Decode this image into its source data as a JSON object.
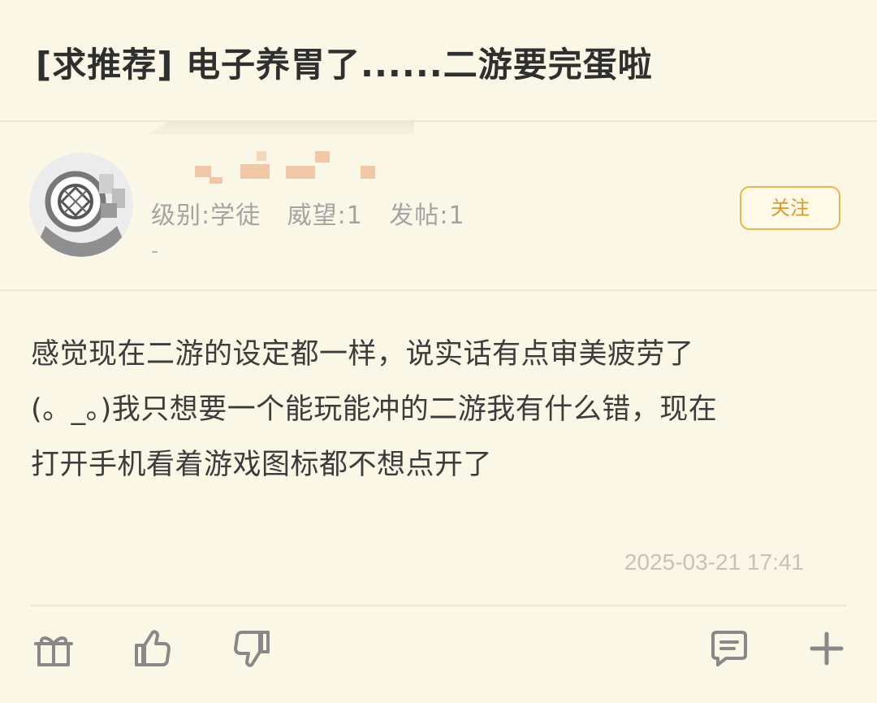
{
  "post": {
    "title": "[求推荐] 电子养胃了......二游要完蛋啦",
    "content": [
      "感觉现在二游的设定都一样，说实话有点审美疲劳了",
      "(。_。)我只想要一个能玩能冲的二游我有什么错，现在",
      "打开手机看着游戏图标都不想点开了"
    ],
    "timestamp": "2025-03-21 17:41"
  },
  "author": {
    "level": "级别:学徒",
    "reputation": "威望:1",
    "posts": "发帖:1",
    "dash": "-",
    "follow_label": "关注"
  },
  "actions": {
    "gift_icon": "gift-icon",
    "like_icon": "thumbs-up-icon",
    "dislike_icon": "thumbs-down-icon",
    "comment_icon": "comment-icon",
    "more_icon": "plus-icon"
  },
  "colors": {
    "background": "#fbf7e6",
    "accent": "#e9b64c",
    "follow_text": "#d99a28"
  }
}
